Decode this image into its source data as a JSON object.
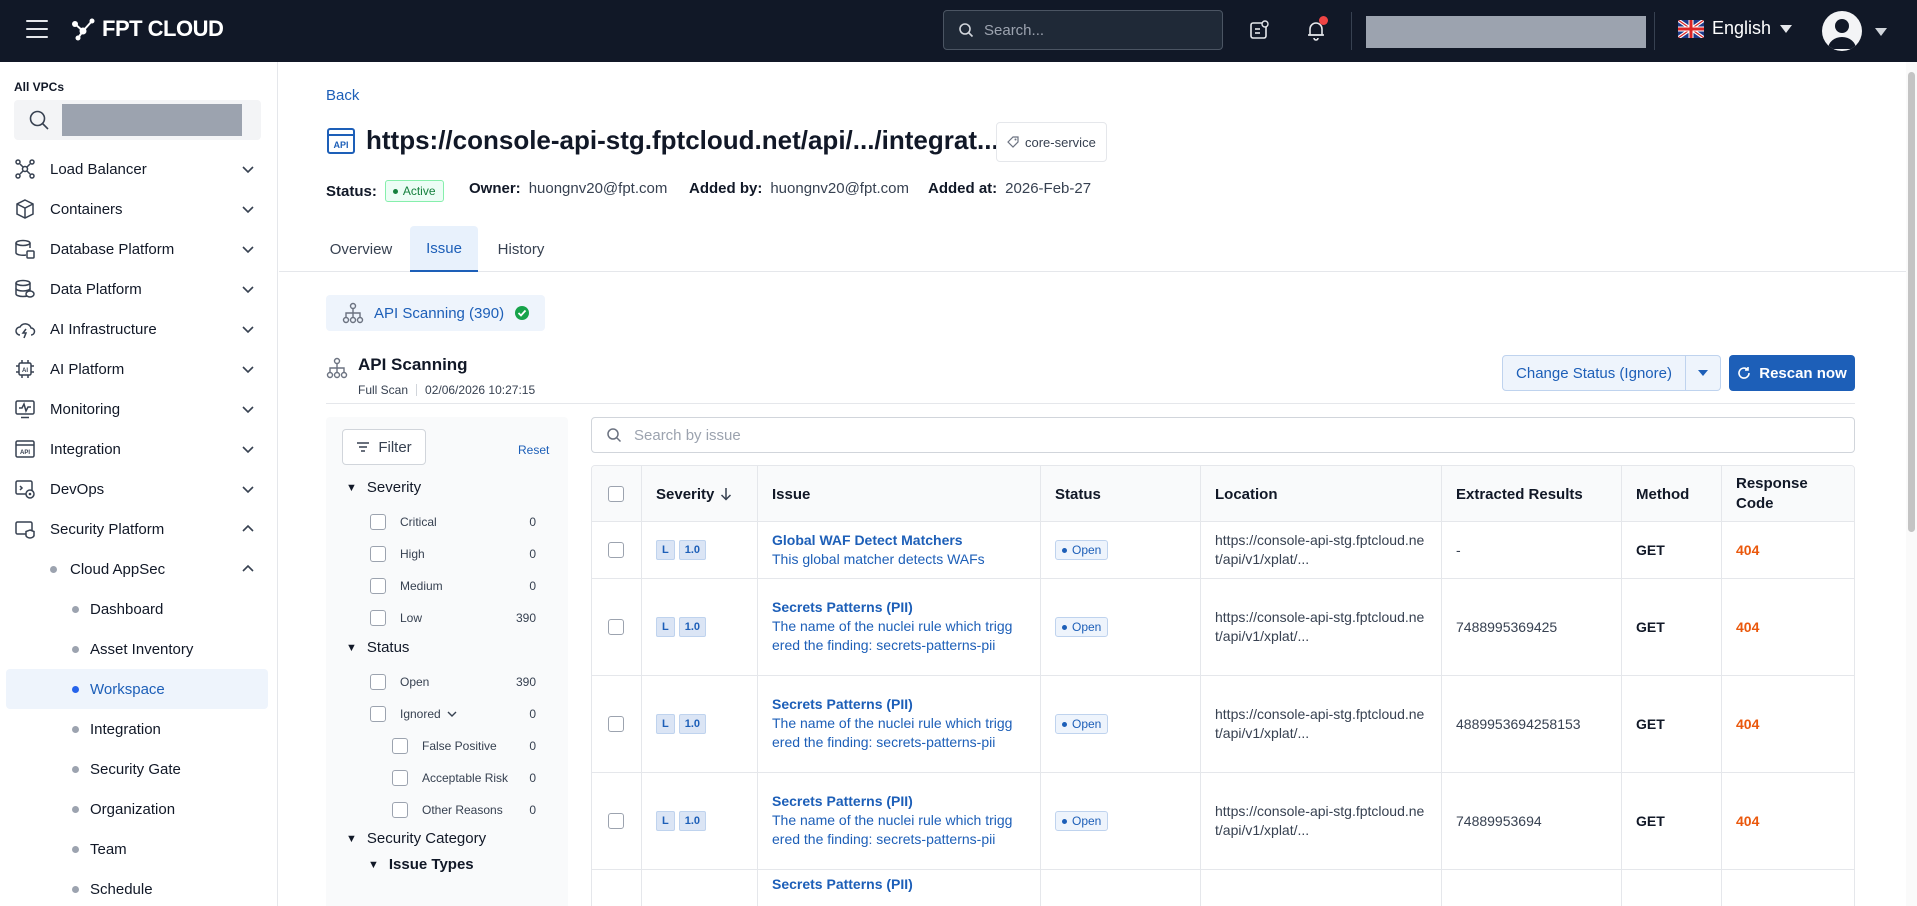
{
  "topbar": {
    "brand": "FPT CLOUD",
    "search_placeholder": "Search...",
    "language": "English"
  },
  "sidebar": {
    "vpc_label": "All VPCs",
    "items": [
      {
        "label": "Load Balancer"
      },
      {
        "label": "Containers"
      },
      {
        "label": "Database Platform"
      },
      {
        "label": "Data Platform"
      },
      {
        "label": "AI Infrastructure"
      },
      {
        "label": "AI Platform"
      },
      {
        "label": "Monitoring"
      },
      {
        "label": "Integration"
      },
      {
        "label": "DevOps"
      },
      {
        "label": "Security Platform"
      }
    ],
    "group": {
      "label": "Cloud AppSec"
    },
    "subitems": [
      {
        "label": "Dashboard"
      },
      {
        "label": "Asset Inventory"
      },
      {
        "label": "Workspace"
      },
      {
        "label": "Integration"
      },
      {
        "label": "Security Gate"
      },
      {
        "label": "Organization"
      },
      {
        "label": "Team"
      },
      {
        "label": "Schedule"
      }
    ]
  },
  "page": {
    "back": "Back",
    "title": "https://console-api-stg.fptcloud.net/api/.../integrat...",
    "tag": "core-service",
    "status_label": "Status:",
    "status_value": "Active",
    "owner_label": "Owner:",
    "owner_value": "huongnv20@fpt.com",
    "added_by_label": "Added by:",
    "added_by_value": "huongnv20@fpt.com",
    "added_at_label": "Added at:",
    "added_at_value": "2026-Feb-27",
    "tabs": [
      {
        "label": "Overview"
      },
      {
        "label": "Issue"
      },
      {
        "label": "History"
      }
    ]
  },
  "scan": {
    "chip_label": "API Scanning (390)",
    "title": "API Scanning",
    "type": "Full Scan",
    "timestamp": "02/06/2026 10:27:15",
    "change_status": "Change Status (Ignore)",
    "rescan": "Rescan now"
  },
  "filter": {
    "button": "Filter",
    "reset": "Reset",
    "severity": {
      "label": "Severity",
      "options": [
        {
          "label": "Critical",
          "count": "0"
        },
        {
          "label": "High",
          "count": "0"
        },
        {
          "label": "Medium",
          "count": "0"
        },
        {
          "label": "Low",
          "count": "390"
        }
      ]
    },
    "status": {
      "label": "Status",
      "options": [
        {
          "label": "Open",
          "count": "390"
        },
        {
          "label": "Ignored",
          "count": "0"
        }
      ],
      "ignored_sub": [
        {
          "label": "False Positive",
          "count": "0"
        },
        {
          "label": "Acceptable Risk",
          "count": "0"
        },
        {
          "label": "Other Reasons",
          "count": "0"
        }
      ]
    },
    "category": {
      "label": "Security Category"
    },
    "issue_types": {
      "label": "Issue Types"
    }
  },
  "table": {
    "search_placeholder": "Search by issue",
    "headers": {
      "severity": "Severity",
      "issue": "Issue",
      "status": "Status",
      "location": "Location",
      "extracted": "Extracted Results",
      "method": "Method",
      "response_code": "Response Code"
    },
    "rows": [
      {
        "sev_level": "L",
        "sev_score": "1.0",
        "title": "Global WAF Detect Matchers",
        "desc": "This global matcher detects WAFs",
        "status": "Open",
        "location": "https://console-api-stg.fptcloud.net/api/v1/xplat/...",
        "extracted": "-",
        "method": "GET",
        "code": "404"
      },
      {
        "sev_level": "L",
        "sev_score": "1.0",
        "title": "Secrets Patterns (PII)",
        "desc": "The name of the nuclei rule which triggered the finding: secrets-patterns-pii",
        "status": "Open",
        "location": "https://console-api-stg.fptcloud.net/api/v1/xplat/...",
        "extracted": "7488995369425",
        "method": "GET",
        "code": "404"
      },
      {
        "sev_level": "L",
        "sev_score": "1.0",
        "title": "Secrets Patterns (PII)",
        "desc": "The name of the nuclei rule which triggered the finding: secrets-patterns-pii",
        "status": "Open",
        "location": "https://console-api-stg.fptcloud.net/api/v1/xplat/...",
        "extracted": "4889953694258153",
        "method": "GET",
        "code": "404"
      },
      {
        "sev_level": "L",
        "sev_score": "1.0",
        "title": "Secrets Patterns (PII)",
        "desc": "The name of the nuclei rule which triggered the finding: secrets-patterns-pii",
        "status": "Open",
        "location": "https://console-api-stg.fptcloud.net/api/v1/xplat/...",
        "extracted": "74889953694",
        "method": "GET",
        "code": "404"
      },
      {
        "sev_level": "",
        "sev_score": "",
        "title": "Secrets Patterns (PII)",
        "desc": "",
        "status": "",
        "location": "",
        "extracted": "",
        "method": "",
        "code": ""
      }
    ]
  }
}
